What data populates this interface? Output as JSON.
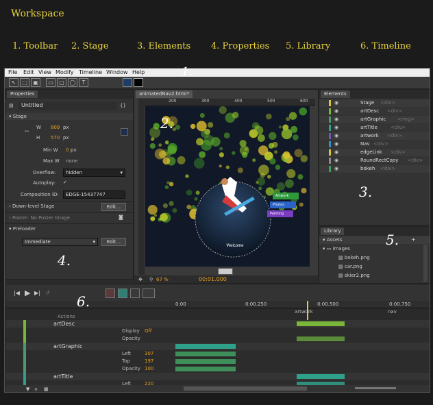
{
  "heading": {
    "title": "Workspace",
    "sections": [
      "1. Toolbar",
      "2. Stage",
      "3. Elements",
      "4. Properties",
      "5. Library",
      "6. Timeline"
    ],
    "markers": [
      "1.",
      "2.",
      "3.",
      "4.",
      "5.",
      "6."
    ]
  },
  "menu": [
    "File",
    "Edit",
    "View",
    "Modify",
    "Timeline",
    "Window",
    "Help"
  ],
  "properties": {
    "tab": "Properties",
    "name": "Untitled",
    "stage_label": "Stage",
    "w_label": "W",
    "w_value": "809",
    "h_label": "H",
    "h_value": "570",
    "unit": "px",
    "minw_label": "Min W",
    "minw_value": "0",
    "maxw_label": "Max W",
    "maxw_value": "none",
    "overflow_label": "Overflow:",
    "overflow_value": "hidden",
    "autoplay_label": "Autoplay:",
    "autoplay_value": "✓",
    "compid_label": "Composition ID:",
    "compid_value": "EDGE-15437747",
    "downlevel_label": "Down-level Stage",
    "edit_label": "Edit...",
    "poster_label": "Poster: No Poster Image",
    "preloader_label": "Preloader",
    "preloader_value": "Immediate"
  },
  "stage": {
    "tab": "animatedNav2.html*",
    "ruler": [
      "200",
      "300",
      "400",
      "500",
      "600"
    ],
    "menu_items": [
      "Artwork",
      "Photos",
      "Painting"
    ],
    "menu_colors": [
      "#2f9a3c",
      "#2b63c9",
      "#7a3cc0"
    ],
    "welcome": "Welcome",
    "zoom": "67 %",
    "time": "00:01.000"
  },
  "elements": {
    "tab": "Elements",
    "items": [
      {
        "name": "Stage",
        "tag": "<div>"
      },
      {
        "name": "artDesc",
        "tag": "<div>"
      },
      {
        "name": "artGraphic",
        "tag": "<img>"
      },
      {
        "name": "artTitle",
        "tag": "<div>"
      },
      {
        "name": "artwork",
        "tag": "<div>"
      },
      {
        "name": "Nav",
        "tag": "<div>"
      },
      {
        "name": "edgeLink",
        "tag": "<div>"
      },
      {
        "name": "RoundRectCopy",
        "tag": "<div>"
      },
      {
        "name": "bokeh",
        "tag": "<div>"
      }
    ]
  },
  "library": {
    "tab": "Library",
    "assets_label": "Assets",
    "folder": "images",
    "files": [
      "bokeh.png",
      "car.png",
      "skier2.png"
    ]
  },
  "timeline": {
    "times": [
      "0:00",
      "0:00.250",
      "0:00.500",
      "0:00.750"
    ],
    "labels": [
      "artwork",
      "nav"
    ],
    "actions_label": "Actions",
    "rows": [
      {
        "type": "group",
        "name": "artDesc"
      },
      {
        "type": "prop",
        "name": "Display",
        "value": "Off"
      },
      {
        "type": "prop",
        "name": "Opacity",
        "value": ""
      },
      {
        "type": "group",
        "name": "artGraphic"
      },
      {
        "type": "prop",
        "name": "Left",
        "value": "307"
      },
      {
        "type": "prop",
        "name": "Top",
        "value": "197"
      },
      {
        "type": "prop",
        "name": "Opacity",
        "value": "100"
      },
      {
        "type": "group",
        "name": "artTitle"
      },
      {
        "type": "prop",
        "name": "Left",
        "value": "220"
      }
    ]
  }
}
